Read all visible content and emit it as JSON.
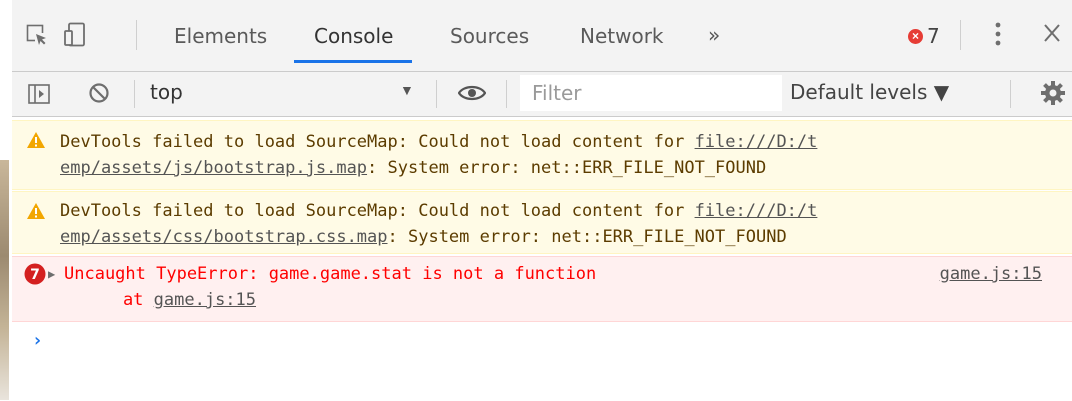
{
  "tabbar": {
    "tabs": [
      {
        "label": "Elements"
      },
      {
        "label": "Console"
      },
      {
        "label": "Sources"
      },
      {
        "label": "Network"
      }
    ],
    "more_label": "»",
    "error_count": "7",
    "error_badge_glyph": "×"
  },
  "toolbar": {
    "context": "top",
    "context_arrow": "▼",
    "filter_placeholder": "Filter",
    "levels_label": "Default levels ▼"
  },
  "messages": [
    {
      "level": "warning",
      "line1_prefix": "DevTools failed to load SourceMap: Could not load content for ",
      "line1_link": "file:///D:/t",
      "line2_link": "emp/assets/js/bootstrap.js.map",
      "line2_suffix": ": System error: net::ERR_FILE_NOT_FOUND"
    },
    {
      "level": "warning",
      "line1_prefix": "DevTools failed to load SourceMap: Could not load content for ",
      "line1_link": "file:///D:/t",
      "line2_link": "emp/assets/css/bootstrap.css.map",
      "line2_suffix": ": System error: net::ERR_FILE_NOT_FOUND"
    },
    {
      "level": "error",
      "repeat_count": "7",
      "expand_glyph": "▶",
      "text": "Uncaught TypeError: game.game.stat is not a function",
      "stack_prefix": "    at ",
      "stack_link": "game.js:15",
      "source_link": "game.js:15"
    }
  ],
  "prompt_glyph": "›",
  "colors": {
    "accent": "#1a73e8",
    "warning_bg": "#fffbe6",
    "error_bg": "#fff0f0",
    "error_text": "#ff0000",
    "error_badge": "#e63c35",
    "warning_icon": "#f2a600"
  },
  "icons": [
    "inspect-element-icon",
    "device-toolbar-icon",
    "sidebar-toggle-icon",
    "clear-console-icon",
    "eye-icon",
    "gear-icon",
    "kebab-menu-icon",
    "close-icon",
    "warning-icon",
    "error-icon"
  ]
}
